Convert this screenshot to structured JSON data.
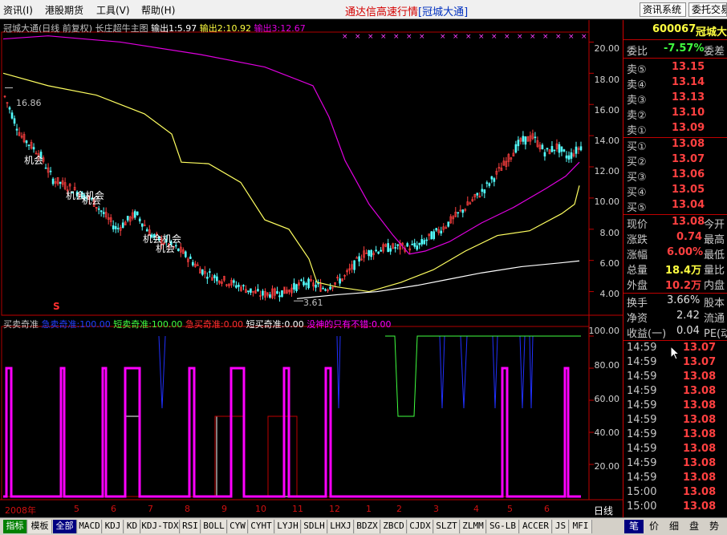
{
  "menu": {
    "items": [
      "资讯(I)",
      "港股期货",
      "工具(V)",
      "帮助(H)"
    ],
    "title": "通达信高速行情",
    "title_stock": "[冠城大通]",
    "btn_news": "资讯系统",
    "btn_trade": "委托交易"
  },
  "chart": {
    "info_name": "冠城大通(日线 前复权)",
    "info_formula": "长庄超牛主图",
    "info_out1": "输出1:5.97",
    "info_out2": "输出2:10.92",
    "info_out3": "输出3:12.67",
    "high_label": "16.86",
    "low_label": "3.61",
    "opportunity": "机会",
    "opportunity_multi": "机会机会",
    "indicator_title": "买卖奇准",
    "ind_fast_sell": "急卖奇准:100.00",
    "ind_short_sell": "短卖奇准:100.00",
    "ind_fast_buy": "急买奇准:0.00",
    "ind_short_buy": "短买奇准:0.00",
    "ind_only_rise": "没神的只有不错:0.00",
    "marker_s": "S",
    "period": "日线",
    "year_label": "2008年",
    "month_labels": [
      "5",
      "6",
      "7",
      "8",
      "9",
      "10",
      "11",
      "12",
      "1",
      "2",
      "3",
      "4",
      "5",
      "6"
    ],
    "main_axis": [
      "20.00",
      "18.00",
      "16.00",
      "14.00",
      "12.00",
      "10.00",
      "8.00",
      "6.00",
      "4.00"
    ],
    "ind_axis": [
      "100.00",
      "80.00",
      "60.00",
      "40.00",
      "20.00"
    ]
  },
  "chart_data": {
    "type": "line",
    "title": "冠城大通(日线 前复权)",
    "main_ylim": [
      3.0,
      21.0
    ],
    "ind_ylim": [
      0,
      100
    ],
    "price_high": 16.86,
    "price_low": 3.61,
    "outputs": [
      {
        "name": "输出1",
        "value": 5.97
      },
      {
        "name": "输出2",
        "value": 10.92
      },
      {
        "name": "输出3",
        "value": 12.67
      }
    ],
    "colors": {
      "up": "#ff4040",
      "down": "#54ffff",
      "magenta_line": "#e000e0",
      "yellow_line": "#ffff60",
      "white_line": "#ffffff",
      "indicator_magenta": "#ff00ff",
      "indicator_blue": "#2030ff",
      "indicator_green": "#40ff40",
      "indicator_red": "#c00000"
    }
  },
  "quote": {
    "code": "600067",
    "name": "冠城大通",
    "wei_bi_label": "委比",
    "wei_bi": "-7.57%",
    "wei_cha_label": "委差",
    "asks": [
      {
        "label": "卖⑤",
        "price": "13.15"
      },
      {
        "label": "卖④",
        "price": "13.14"
      },
      {
        "label": "卖③",
        "price": "13.13"
      },
      {
        "label": "卖②",
        "price": "13.10"
      },
      {
        "label": "卖①",
        "price": "13.09"
      }
    ],
    "bids": [
      {
        "label": "买①",
        "price": "13.08"
      },
      {
        "label": "买②",
        "price": "13.07"
      },
      {
        "label": "买③",
        "price": "13.06"
      },
      {
        "label": "买④",
        "price": "13.05"
      },
      {
        "label": "买⑤",
        "price": "13.04"
      }
    ],
    "stats": [
      {
        "label": "现价",
        "value": "13.08",
        "extra": "今开",
        "color": "#ff4040"
      },
      {
        "label": "涨跌",
        "value": "0.74",
        "extra": "最高",
        "color": "#ff4040"
      },
      {
        "label": "涨幅",
        "value": "6.00%",
        "extra": "最低",
        "color": "#ff4040"
      },
      {
        "label": "总量",
        "value": "18.4万",
        "extra": "量比",
        "color": "#ffff40"
      },
      {
        "label": "外盘",
        "value": "10.2万",
        "extra": "内盘",
        "color": "#ff4040"
      }
    ],
    "stats2": [
      {
        "label": "换手",
        "value": "3.66%",
        "extra": "股本",
        "color": "#e0e0e0"
      },
      {
        "label": "净资",
        "value": "2.42",
        "extra": "流通",
        "color": "#e0e0e0"
      },
      {
        "label": "收益(一)",
        "value": "0.04",
        "extra": "PE(动)",
        "color": "#e0e0e0"
      }
    ],
    "ticks": [
      {
        "time": "14:59",
        "price": "13.07"
      },
      {
        "time": "14:59",
        "price": "13.07"
      },
      {
        "time": "14:59",
        "price": "13.08"
      },
      {
        "time": "14:59",
        "price": "13.08"
      },
      {
        "time": "14:59",
        "price": "13.08"
      },
      {
        "time": "14:59",
        "price": "13.08"
      },
      {
        "time": "14:59",
        "price": "13.08"
      },
      {
        "time": "14:59",
        "price": "13.08"
      },
      {
        "time": "14:59",
        "price": "13.08"
      },
      {
        "time": "14:59",
        "price": "13.08"
      },
      {
        "time": "15:00",
        "price": "13.08"
      },
      {
        "time": "15:00",
        "price": "13.08"
      }
    ]
  },
  "tabs": {
    "items": [
      "指标",
      "模板",
      "全部",
      "MACD",
      "KDJ",
      "KD",
      "KDJ-TDX",
      "RSI",
      "BOLL",
      "CYW",
      "CYHT",
      "LYJH",
      "SDLH",
      "LHXJ",
      "BDZX",
      "ZBCD",
      "CJDX",
      "SLZT",
      "ZLMM",
      "SG-LB",
      "ACCER",
      "JS",
      "MFI"
    ],
    "right": [
      "笔",
      "价",
      "细",
      "盘",
      "势"
    ]
  }
}
